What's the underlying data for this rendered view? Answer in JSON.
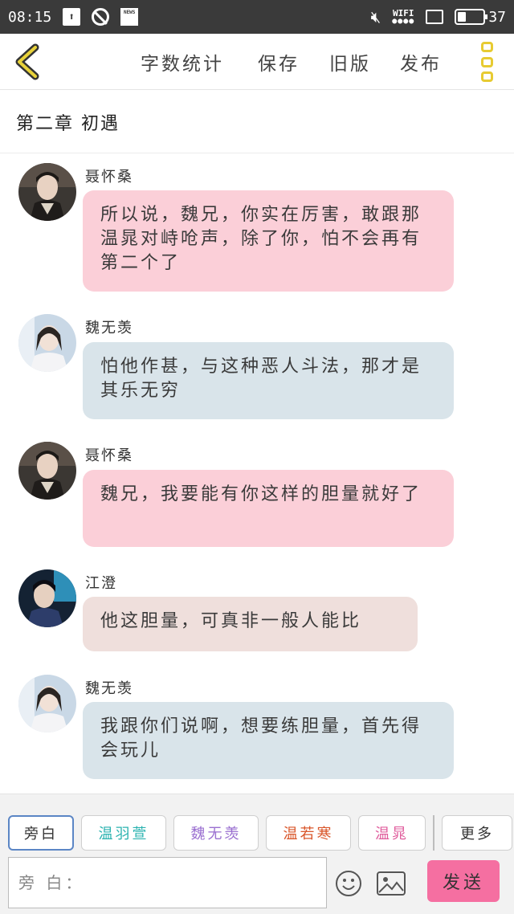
{
  "status_bar": {
    "time": "08:15",
    "wifi_label": "WIFI",
    "news_label": "NEWS",
    "battery": "37"
  },
  "toolbar": {
    "word_count": "字数统计",
    "save": "保存",
    "old_version": "旧版",
    "publish": "发布"
  },
  "chapter_title": "第二章  初遇",
  "messages": [
    {
      "name": "聂怀桑",
      "text": "所以说，魏兄，你实在厉害，敢跟那温晁对峙呛声，除了你，怕不会再有第二个了"
    },
    {
      "name": "魏无羡",
      "text": "怕他作甚，与这种恶人斗法，那才是其乐无穷"
    },
    {
      "name": "聂怀桑",
      "text": "魏兄，我要能有你这样的胆量就好了"
    },
    {
      "name": "江澄",
      "text": "他这胆量，可真非一般人能比"
    },
    {
      "name": "魏无羡",
      "text": "我跟你们说啊，想要练胆量，首先得会玩儿"
    }
  ],
  "roles": [
    {
      "label": "旁白",
      "color": "#555555"
    },
    {
      "label": "温羽萱",
      "color": "#2bb3b0"
    },
    {
      "label": "魏无羡",
      "color": "#9a6fd0"
    },
    {
      "label": "温若寒",
      "color": "#d9572b"
    },
    {
      "label": "温晁",
      "color": "#e05c9c"
    },
    {
      "label": "更多",
      "color": "#555555"
    }
  ],
  "input": {
    "placeholder": "旁 白："
  },
  "send": "发送",
  "icons": [
    "back-chevron-icon",
    "more-menu-icon",
    "emoji-icon",
    "image-icon"
  ]
}
